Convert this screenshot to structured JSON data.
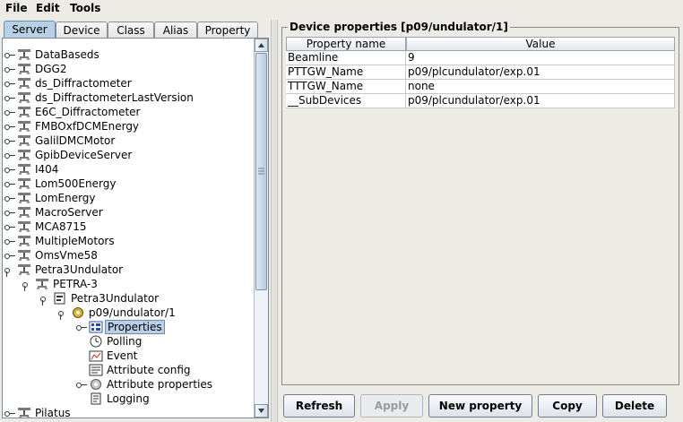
{
  "menu": [
    "File",
    "Edit",
    "Tools"
  ],
  "tabs": [
    "Server",
    "Device",
    "Class",
    "Alias",
    "Property"
  ],
  "tree": [
    {
      "label": "DataBaseds",
      "depth": 0,
      "icon": "server-icon",
      "open": false
    },
    {
      "label": "DGG2",
      "depth": 0,
      "icon": "server-icon",
      "open": false
    },
    {
      "label": "ds_Diffractometer",
      "depth": 0,
      "icon": "server-icon",
      "open": false
    },
    {
      "label": "ds_DiffractometerLastVersion",
      "depth": 0,
      "icon": "server-icon",
      "open": false
    },
    {
      "label": "E6C_Diffractometer",
      "depth": 0,
      "icon": "server-icon",
      "open": false
    },
    {
      "label": "FMBOxfDCMEnergy",
      "depth": 0,
      "icon": "server-icon",
      "open": false
    },
    {
      "label": "GalilDMCMotor",
      "depth": 0,
      "icon": "server-icon",
      "open": false
    },
    {
      "label": "GpibDeviceServer",
      "depth": 0,
      "icon": "server-icon",
      "open": false
    },
    {
      "label": "I404",
      "depth": 0,
      "icon": "server-icon",
      "open": false
    },
    {
      "label": "Lom500Energy",
      "depth": 0,
      "icon": "server-icon",
      "open": false
    },
    {
      "label": "LomEnergy",
      "depth": 0,
      "icon": "server-icon",
      "open": false
    },
    {
      "label": "MacroServer",
      "depth": 0,
      "icon": "server-icon",
      "open": false
    },
    {
      "label": "MCA8715",
      "depth": 0,
      "icon": "server-icon",
      "open": false
    },
    {
      "label": "MultipleMotors",
      "depth": 0,
      "icon": "server-icon",
      "open": false
    },
    {
      "label": "OmsVme58",
      "depth": 0,
      "icon": "server-icon",
      "open": false
    },
    {
      "label": "Petra3Undulator",
      "depth": 0,
      "icon": "server-icon",
      "open": true
    },
    {
      "label": "PETRA-3",
      "depth": 1,
      "icon": "server-icon",
      "open": true
    },
    {
      "label": "Petra3Undulator",
      "depth": 2,
      "icon": "class-icon",
      "open": true
    },
    {
      "label": "p09/undulator/1",
      "depth": 3,
      "icon": "device-icon",
      "open": true
    },
    {
      "label": "Properties",
      "depth": 4,
      "icon": "properties-icon",
      "open": false,
      "selected": true
    },
    {
      "label": "Polling",
      "depth": 4,
      "icon": "polling-icon",
      "leaf": true
    },
    {
      "label": "Event",
      "depth": 4,
      "icon": "event-icon",
      "leaf": true
    },
    {
      "label": "Attribute config",
      "depth": 4,
      "icon": "attribute-config-icon",
      "leaf": true
    },
    {
      "label": "Attribute properties",
      "depth": 4,
      "icon": "attribute-properties-icon",
      "open": false
    },
    {
      "label": "Logging",
      "depth": 4,
      "icon": "logging-icon",
      "leaf": true
    },
    {
      "label": "Pilatus",
      "depth": 0,
      "icon": "server-icon",
      "open": false
    }
  ],
  "props_panel": {
    "title": "Device properties [p09/undulator/1]",
    "headers": [
      "Property name",
      "Value"
    ],
    "rows": [
      [
        "Beamline",
        "9"
      ],
      [
        "PTTGW_Name",
        "p09/plcundulator/exp.01"
      ],
      [
        "TTTGW_Name",
        "none"
      ],
      [
        "__SubDevices",
        "p09/plcundulator/exp.01"
      ]
    ]
  },
  "buttons": {
    "refresh": "Refresh",
    "apply": "Apply",
    "new_property": "New property",
    "copy": "Copy",
    "delete": "Delete"
  },
  "colors": {
    "selection": "#b8cfe5",
    "tab_active": "#b8cfe5",
    "panel_bg": "#ecebe6"
  }
}
